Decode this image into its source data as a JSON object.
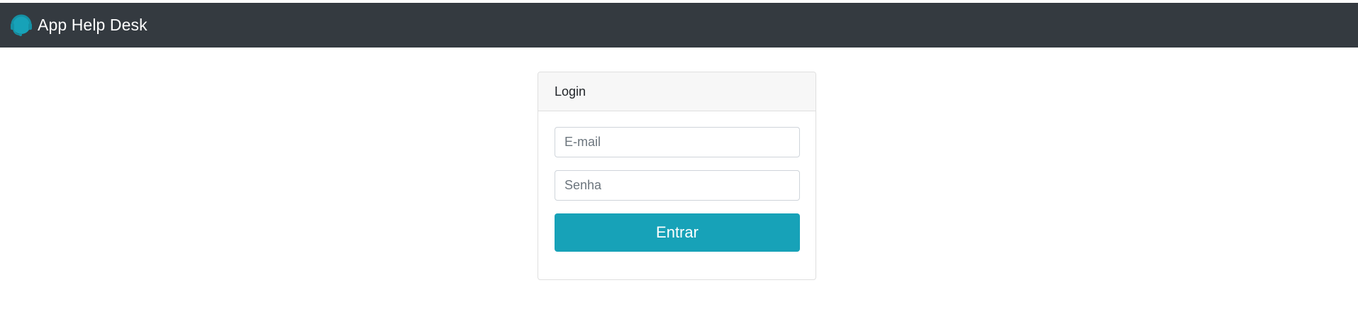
{
  "navbar": {
    "brand_text": "App Help Desk",
    "brand_icon": "headset-icon",
    "background_color": "#343a40"
  },
  "login": {
    "title": "Login",
    "email_placeholder": "E-mail",
    "email_value": "",
    "password_placeholder": "Senha",
    "password_value": "",
    "submit_label": "Entrar",
    "submit_color": "#17a2b8"
  }
}
